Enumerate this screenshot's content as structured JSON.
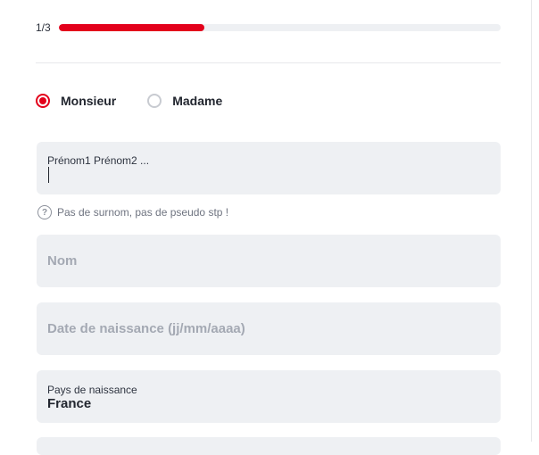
{
  "progress": {
    "step_label": "1/3",
    "fraction": 0.33
  },
  "gender": {
    "options": [
      {
        "label": "Monsieur",
        "selected": true
      },
      {
        "label": "Madame",
        "selected": false
      }
    ]
  },
  "first_name": {
    "label": "Prénom1 Prénom2 ...",
    "value": ""
  },
  "hint": {
    "icon": "question-circle-icon",
    "text": "Pas de surnom, pas de pseudo stp !"
  },
  "last_name": {
    "placeholder": "Nom"
  },
  "birth_date": {
    "placeholder": "Date de naissance (jj/mm/aaaa)"
  },
  "birth_country": {
    "label": "Pays de naissance",
    "value": "France"
  },
  "colors": {
    "accent": "#e3001b",
    "field_bg": "#eef0f3"
  }
}
